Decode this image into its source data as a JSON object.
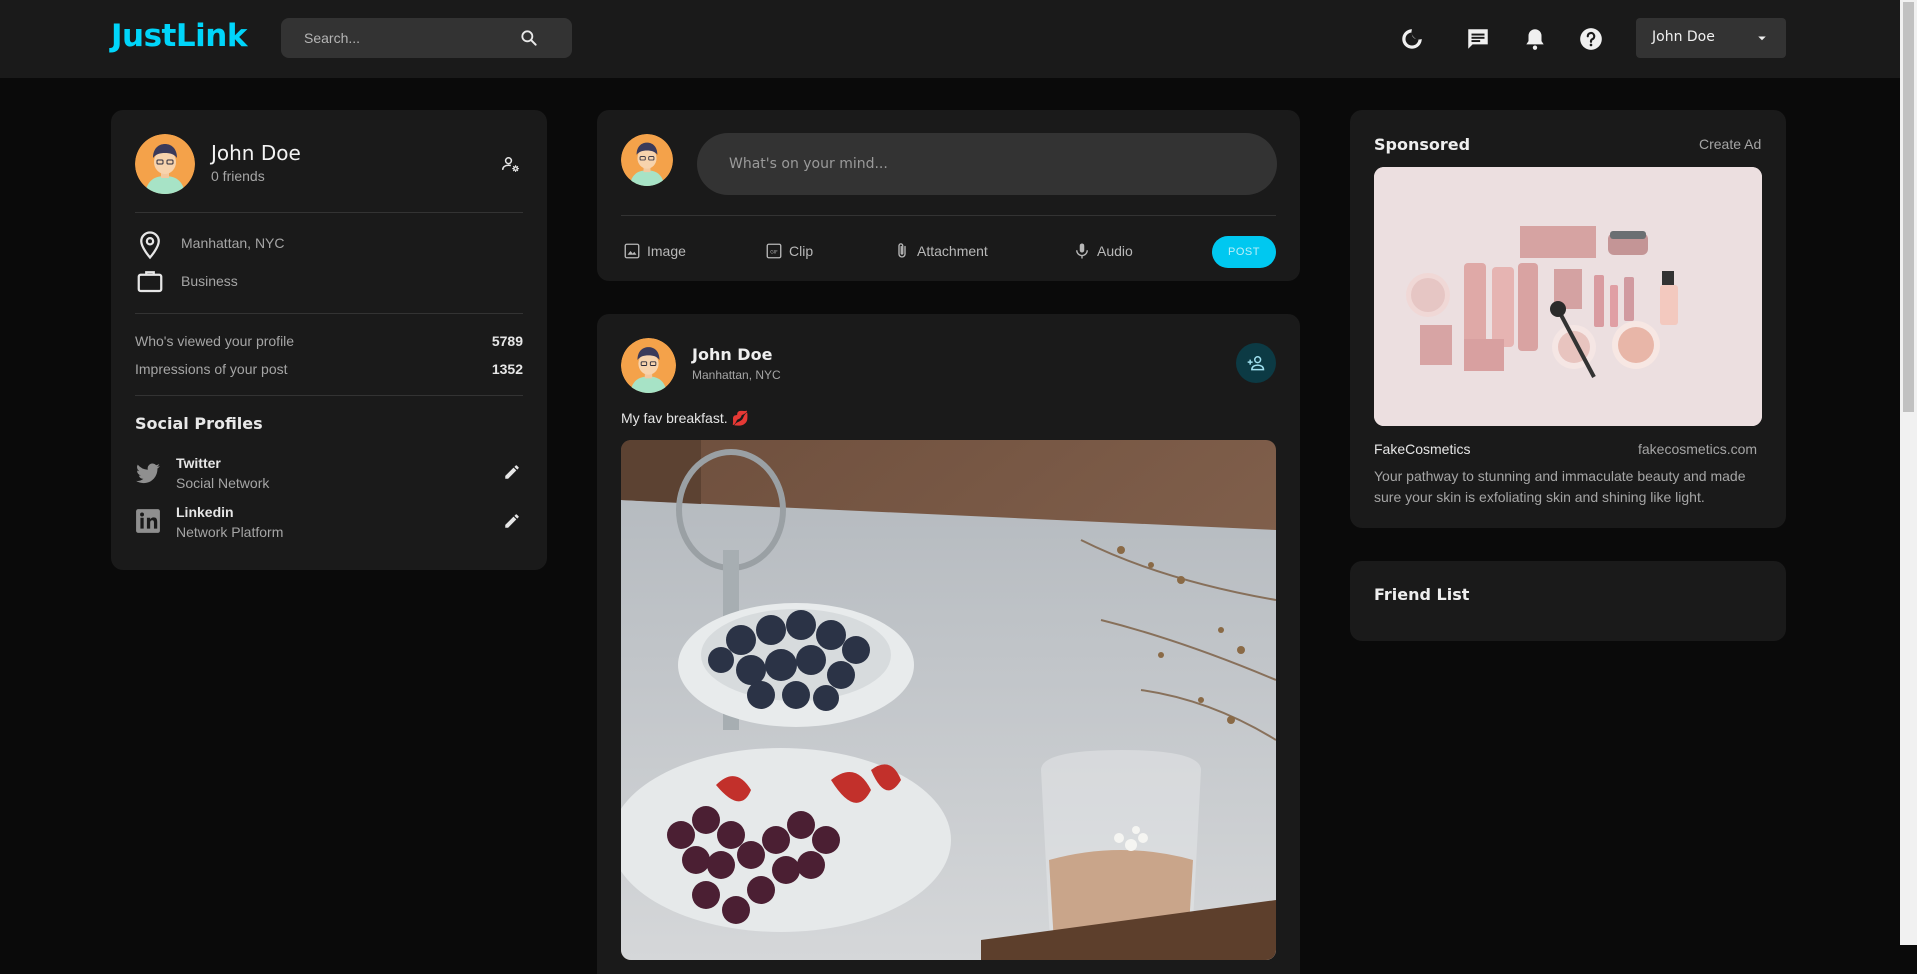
{
  "navbar": {
    "logo": "JustLink",
    "search_placeholder": "Search...",
    "icons": [
      "moon-icon",
      "chat-icon",
      "bell-icon",
      "help-icon"
    ],
    "user_name": "John Doe"
  },
  "profile_card": {
    "name": "John Doe",
    "friends": "0 friends",
    "location": "Manhattan, NYC",
    "occupation": "Business",
    "stats": [
      {
        "label": "Who's viewed your profile",
        "value": "5789"
      },
      {
        "label": "Impressions of your post",
        "value": "1352"
      }
    ],
    "social_title": "Social Profiles",
    "socials": [
      {
        "name": "Twitter",
        "sub": "Social Network"
      },
      {
        "name": "Linkedin",
        "sub": "Network Platform"
      }
    ]
  },
  "composer": {
    "placeholder": "What's on your mind...",
    "tools": [
      "Image",
      "Clip",
      "Attachment",
      "Audio"
    ],
    "post_label": "POST"
  },
  "post": {
    "author": "John Doe",
    "location": "Manhattan, NYC",
    "text": "My fav breakfast. 💋"
  },
  "sponsored": {
    "title": "Sponsored",
    "create_ad": "Create Ad",
    "brand": "FakeCosmetics",
    "url": "fakecosmetics.com",
    "description": "Your pathway to stunning and immaculate beauty and made sure your skin is exfoliating skin and shining like light."
  },
  "friend_list": {
    "title": "Friend List"
  },
  "colors": {
    "accent": "#00d5fa",
    "background": "#0a0a0a",
    "card": "#1a1a1a",
    "input": "#333333"
  }
}
